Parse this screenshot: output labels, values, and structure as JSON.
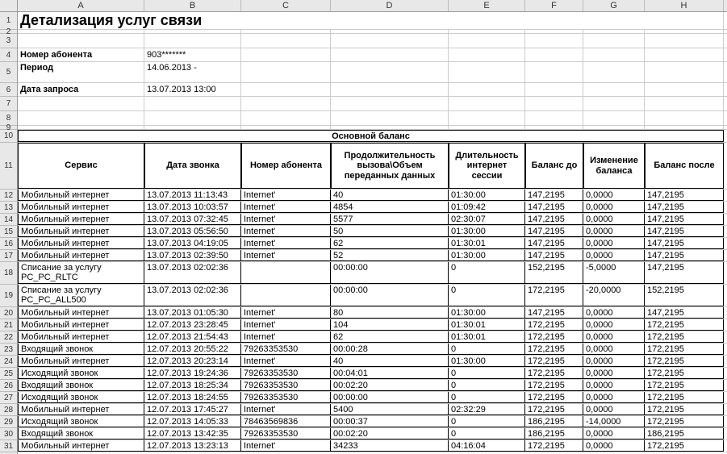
{
  "columns": [
    "A",
    "B",
    "C",
    "D",
    "E",
    "F",
    "G",
    "H"
  ],
  "row_numbers": [
    1,
    2,
    3,
    4,
    5,
    6,
    7,
    8,
    9,
    10,
    11,
    12,
    13,
    14,
    15,
    16,
    17,
    18,
    19,
    20,
    21,
    22,
    23,
    24,
    25,
    26,
    27,
    28,
    29,
    30,
    31
  ],
  "title": "Детализация услуг связи",
  "info": {
    "subscriber_label": "Номер абонента",
    "subscriber_value": "903*******",
    "period_label": "Период",
    "period_value": "14.06.2013 -",
    "request_label": "Дата запроса",
    "request_value": "13.07.2013 13:00"
  },
  "section_title": "Основной баланс",
  "table_headers": {
    "service": "Сервис",
    "call_date": "Дата звонка",
    "subscriber": "Номер абонента",
    "duration": "Продолжительность вызова\\Объем переданных данных",
    "session": "Длительность интернет сессии",
    "balance_before": "Баланс до",
    "balance_change": "Изменение баланса",
    "balance_after": "Баланс после"
  },
  "chart_data": {
    "type": "table",
    "columns": [
      "Сервис",
      "Дата звонка",
      "Номер абонента",
      "Продолжительность вызова\\Объем переданных данных",
      "Длительность интернет сессии",
      "Баланс до",
      "Изменение баланса",
      "Баланс после"
    ],
    "rows": [
      [
        "Мобильный интернет",
        "13.07.2013 11:13:43",
        "Internet'",
        "40",
        "01:30:00",
        "147,2195",
        "0,0000",
        "147,2195"
      ],
      [
        "Мобильный интернет",
        "13.07.2013 10:03:57",
        "Internet'",
        "4854",
        "01:09:42",
        "147,2195",
        "0,0000",
        "147,2195"
      ],
      [
        "Мобильный интернет",
        "13.07.2013 07:32:45",
        "Internet'",
        "5577",
        "02:30:07",
        "147,2195",
        "0,0000",
        "147,2195"
      ],
      [
        "Мобильный интернет",
        "13.07.2013 05:56:50",
        "Internet'",
        "50",
        "01:30:00",
        "147,2195",
        "0,0000",
        "147,2195"
      ],
      [
        "Мобильный интернет",
        "13.07.2013 04:19:05",
        "Internet'",
        "62",
        "01:30:01",
        "147,2195",
        "0,0000",
        "147,2195"
      ],
      [
        "Мобильный интернет",
        "13.07.2013 02:39:50",
        "Internet'",
        "52",
        "01:30:00",
        "147,2195",
        "0,0000",
        "147,2195"
      ],
      [
        "Списание за услугу PC_PC_RLTC",
        "13.07.2013 02:02:36",
        "",
        "00:00:00",
        "0",
        "152,2195",
        "-5,0000",
        "147,2195"
      ],
      [
        "Списание за услугу PC_PC_ALL500",
        "13.07.2013 02:02:36",
        "",
        "00:00:00",
        "0",
        "172,2195",
        "-20,0000",
        "152,2195"
      ],
      [
        "Мобильный интернет",
        "13.07.2013 01:05:30",
        "Internet'",
        "80",
        "01:30:00",
        "147,2195",
        "0,0000",
        "147,2195"
      ],
      [
        "Мобильный интернет",
        "12.07.2013 23:28:45",
        "Internet'",
        "104",
        "01:30:01",
        "172,2195",
        "0,0000",
        "172,2195"
      ],
      [
        "Мобильный интернет",
        "12.07.2013 21:54:43",
        "Internet'",
        "62",
        "01:30:01",
        "172,2195",
        "0,0000",
        "172,2195"
      ],
      [
        "Входящий звонок",
        "12.07.2013 20:55:22",
        "79263353530",
        "00:00:28",
        "0",
        "172,2195",
        "0,0000",
        "172,2195"
      ],
      [
        "Мобильный интернет",
        "12.07.2013 20:23:14",
        "Internet'",
        "40",
        "01:30:00",
        "172,2195",
        "0,0000",
        "172,2195"
      ],
      [
        "Исходящий звонок",
        "12.07.2013 19:24:36",
        "79263353530",
        "00:04:01",
        "0",
        "172,2195",
        "0,0000",
        "172,2195"
      ],
      [
        "Входящий звонок",
        "12.07.2013 18:25:34",
        "79263353530",
        "00:02:20",
        "0",
        "172,2195",
        "0,0000",
        "172,2195"
      ],
      [
        "Исходящий звонок",
        "12.07.2013 18:24:55",
        "79263353530",
        "00:00:00",
        "0",
        "172,2195",
        "0,0000",
        "172,2195"
      ],
      [
        "Мобильный интернет",
        "12.07.2013 17:45:27",
        "Internet'",
        "5400",
        "02:32:29",
        "172,2195",
        "0,0000",
        "172,2195"
      ],
      [
        "Исходящий звонок",
        "12.07.2013 14:05:33",
        "78463569836",
        "00:00:37",
        "0",
        "186,2195",
        "-14,0000",
        "172,2195"
      ],
      [
        "Входящий звонок",
        "12.07.2013 13:42:35",
        "79263353530",
        "00:02:20",
        "0",
        "186,2195",
        "0,0000",
        "186,2195"
      ],
      [
        "Мобильный интернет",
        "12.07.2013 13:23:13",
        "Internet'",
        "34233",
        "04:16:04",
        "172,2195",
        "0,0000",
        "172,2195"
      ]
    ]
  },
  "row_heights": {
    "title": 22,
    "empty": 18,
    "info": 17,
    "period": 26,
    "section": 16,
    "header": 58,
    "data": 15,
    "multi": 28
  }
}
